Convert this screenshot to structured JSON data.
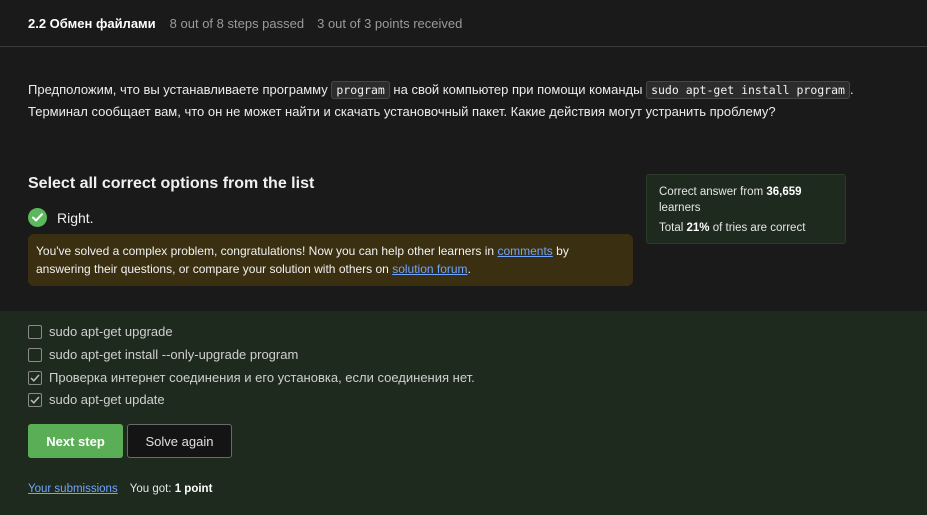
{
  "header": {
    "step_title": "2.2 Обмен файлами",
    "steps_passed": "8 out of 8 steps passed",
    "points_received": "3 out of 3 points  received"
  },
  "question": {
    "part1": "Предположим, что вы устанавливаете программу ",
    "code1": "program",
    "part2": " на свой компьютер при помощи команды ",
    "code2": "sudo apt-get install program",
    "part3": ". Терминал сообщает вам, что он не может найти и скачать установочный пакет. Какие действия могут устранить проблему?"
  },
  "quiz": {
    "heading": "Select all correct options from the list",
    "result_label": "Right."
  },
  "congrats": {
    "text1": "You've solved a complex problem, congratulations! Now you can help other learners in ",
    "comments_link": "comments",
    "text2": " by answering their questions, or compare your solution with others on ",
    "forum_link": "solution forum",
    "text3": "."
  },
  "stats": {
    "correct_prefix": "Correct answer from ",
    "learners_count": "36,659",
    "learners_suffix": " learners",
    "total_prefix": "Total ",
    "percent": "21%",
    "total_suffix": " of tries are correct"
  },
  "options": [
    {
      "label": "sudo apt-get upgrade",
      "checked": false
    },
    {
      "label": "sudo apt-get install --only-upgrade program",
      "checked": false
    },
    {
      "label": "Проверка интернет соединения и его установка, если соединения нет.",
      "checked": true
    },
    {
      "label": "sudo apt-get update",
      "checked": true
    }
  ],
  "buttons": {
    "next_step": "Next step",
    "solve_again": "Solve again"
  },
  "footer": {
    "submissions_link": "Your submissions",
    "you_got": "You got: ",
    "points": "1 point"
  },
  "colors": {
    "accent_green": "#5aae55",
    "link_blue": "#6fa4ff",
    "congrats_bg": "#3a2f10",
    "answers_bg": "#1f2a1e"
  }
}
